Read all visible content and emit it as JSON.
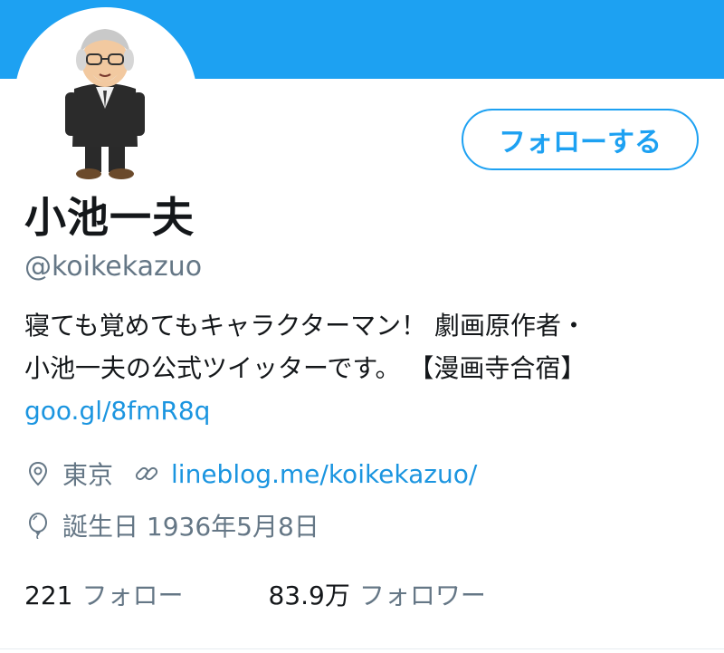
{
  "profile": {
    "display_name": "小池一夫",
    "handle": "@koikekazuo",
    "follow_button_label": "フォローする",
    "bio_line1": "寝ても覚めてもキャラクターマン！ 劇画原作者・",
    "bio_line2": "小池一夫の公式ツイッターです。 【漫画寺合宿】",
    "bio_link": "goo.gl/8fmR8q",
    "location": "東京",
    "website": "lineblog.me/koikekazuo/",
    "birthday": "誕生日 1936年5月8日",
    "following_count": "221",
    "following_label": "フォロー",
    "followers_count": "83.9万",
    "followers_label": "フォロワー"
  },
  "icons": {
    "location": "location-pin-icon",
    "website": "link-icon",
    "birthday": "balloon-icon"
  },
  "colors": {
    "banner": "#1da1f2",
    "accent": "#1da1f2",
    "link": "#1b95e0",
    "text": "#14171a",
    "muted": "#657786"
  }
}
